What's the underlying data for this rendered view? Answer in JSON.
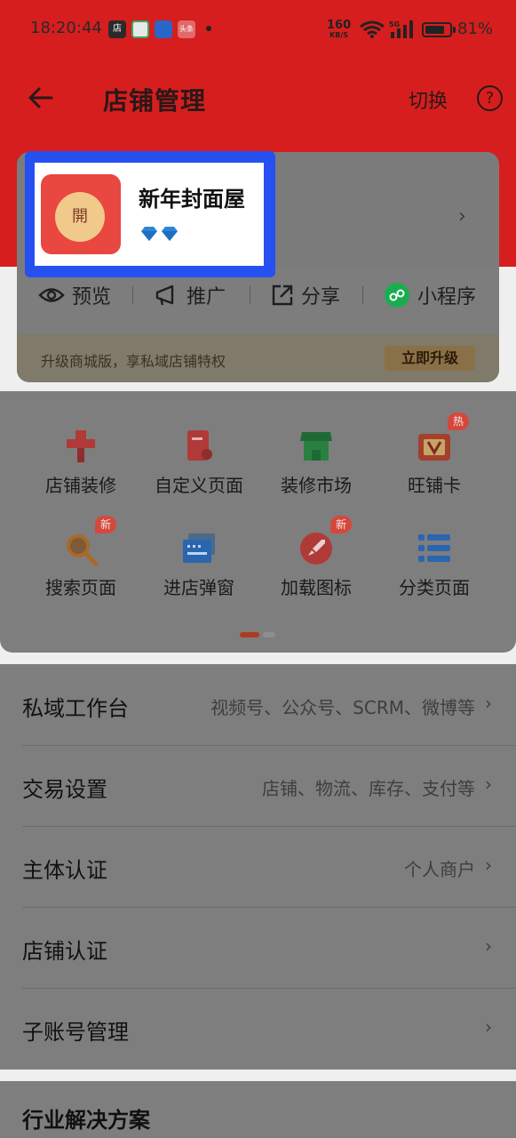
{
  "status_bar": {
    "time": "18:20:44",
    "net_speed_value": "160",
    "net_speed_unit": "KB/S",
    "battery_percent": "81%",
    "battery_level": 0.81,
    "icons": [
      "store-app-icon",
      "refresh-app-icon",
      "bag-app-icon",
      "toutiao-app-icon",
      "wifi-icon",
      "5g-signal-icon",
      "battery-icon"
    ]
  },
  "nav": {
    "title": "店铺管理",
    "switch_label": "切换",
    "help_glyph": "?"
  },
  "store": {
    "logo_char": "開",
    "name": "新年封面屋",
    "gem_icons": [
      "diamond-icon",
      "diamond-icon"
    ]
  },
  "actions": [
    {
      "label": "预览",
      "icon": "eye-icon"
    },
    {
      "label": "推广",
      "icon": "megaphone-icon"
    },
    {
      "label": "分享",
      "icon": "share-icon"
    },
    {
      "label": "小程序",
      "icon": "miniprogram-icon"
    }
  ],
  "upgrade": {
    "text": "升级商城版，享私域店铺特权",
    "button": "立即升级"
  },
  "grid": [
    {
      "label": "店铺装修",
      "icon": "brush-icon",
      "badge": ""
    },
    {
      "label": "自定义页面",
      "icon": "custom-page-icon",
      "badge": ""
    },
    {
      "label": "装修市场",
      "icon": "market-icon",
      "badge": ""
    },
    {
      "label": "旺铺卡",
      "icon": "card-icon",
      "badge": "热"
    },
    {
      "label": "搜索页面",
      "icon": "search-icon",
      "badge": "新"
    },
    {
      "label": "进店弹窗",
      "icon": "popup-icon",
      "badge": ""
    },
    {
      "label": "加载图标",
      "icon": "rocket-icon",
      "badge": "新"
    },
    {
      "label": "分类页面",
      "icon": "list-icon",
      "badge": ""
    }
  ],
  "menu": [
    {
      "label": "私域工作台",
      "value": "视频号、公众号、SCRM、微博等"
    },
    {
      "label": "交易设置",
      "value": "店铺、物流、库存、支付等"
    },
    {
      "label": "主体认证",
      "value": "个人商户"
    },
    {
      "label": "店铺认证",
      "value": ""
    },
    {
      "label": "子账号管理",
      "value": ""
    }
  ],
  "section2": {
    "title": "行业解决方案"
  },
  "colors": {
    "brand_red": "#d61e1e",
    "highlight_blue": "#2650f0",
    "miniprogram_green": "#1aad50",
    "badge_red": "#d4483c"
  }
}
